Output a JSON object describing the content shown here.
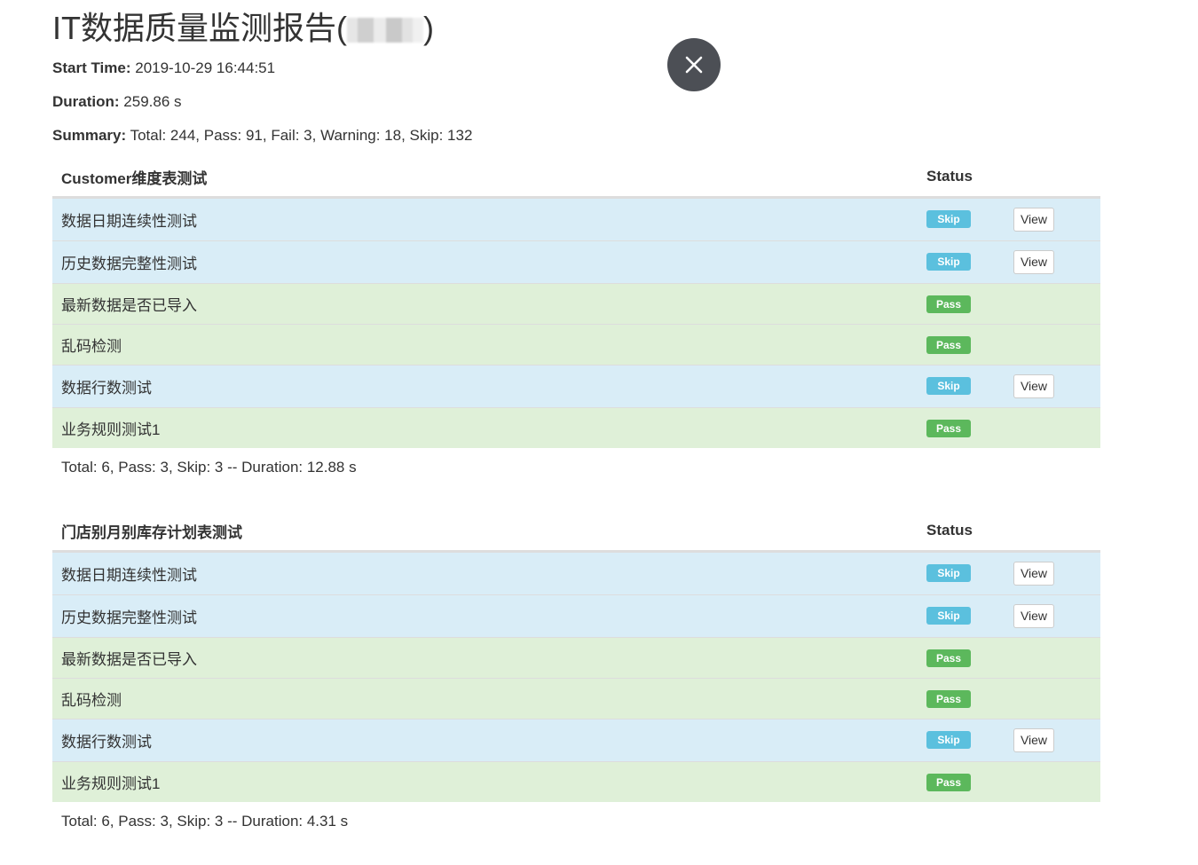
{
  "report": {
    "title_prefix": "IT数据质量监测报告(",
    "title_suffix": ")",
    "start_time_label": "Start Time:",
    "start_time": "2019-10-29 16:44:51",
    "duration_label": "Duration:",
    "duration": "259.86 s",
    "summary_label": "Summary:",
    "summary": "Total: 244, Pass: 91, Fail: 3, Warning: 18, Skip: 132"
  },
  "close_icon": "close-icon",
  "suites": [
    {
      "name": "Customer维度表测试",
      "status_header": "Status",
      "rows": [
        {
          "name": "数据日期连续性测试",
          "status": "Skip",
          "view": "View"
        },
        {
          "name": "历史数据完整性测试",
          "status": "Skip",
          "view": "View"
        },
        {
          "name": "最新数据是否已导入",
          "status": "Pass"
        },
        {
          "name": "乱码检测",
          "status": "Pass"
        },
        {
          "name": "数据行数测试",
          "status": "Skip",
          "view": "View"
        },
        {
          "name": "业务规则测试1",
          "status": "Pass"
        }
      ],
      "totals": "Total: 6, Pass: 3, Skip: 3 -- Duration: 12.88 s"
    },
    {
      "name": "门店别月别库存计划表测试",
      "status_header": "Status",
      "rows": [
        {
          "name": "数据日期连续性测试",
          "status": "Skip",
          "view": "View"
        },
        {
          "name": "历史数据完整性测试",
          "status": "Skip",
          "view": "View"
        },
        {
          "name": "最新数据是否已导入",
          "status": "Pass"
        },
        {
          "name": "乱码检测",
          "status": "Pass"
        },
        {
          "name": "数据行数测试",
          "status": "Skip",
          "view": "View"
        },
        {
          "name": "业务规则测试1",
          "status": "Pass"
        }
      ],
      "totals": "Total: 6, Pass: 3, Skip: 3 -- Duration: 4.31 s"
    }
  ],
  "colors": {
    "skip_row": "#d9edf7",
    "pass_row": "#dff0d8",
    "skip_badge": "#5bc0de",
    "pass_badge": "#5cb85c",
    "close_button": "#4c4f55"
  }
}
